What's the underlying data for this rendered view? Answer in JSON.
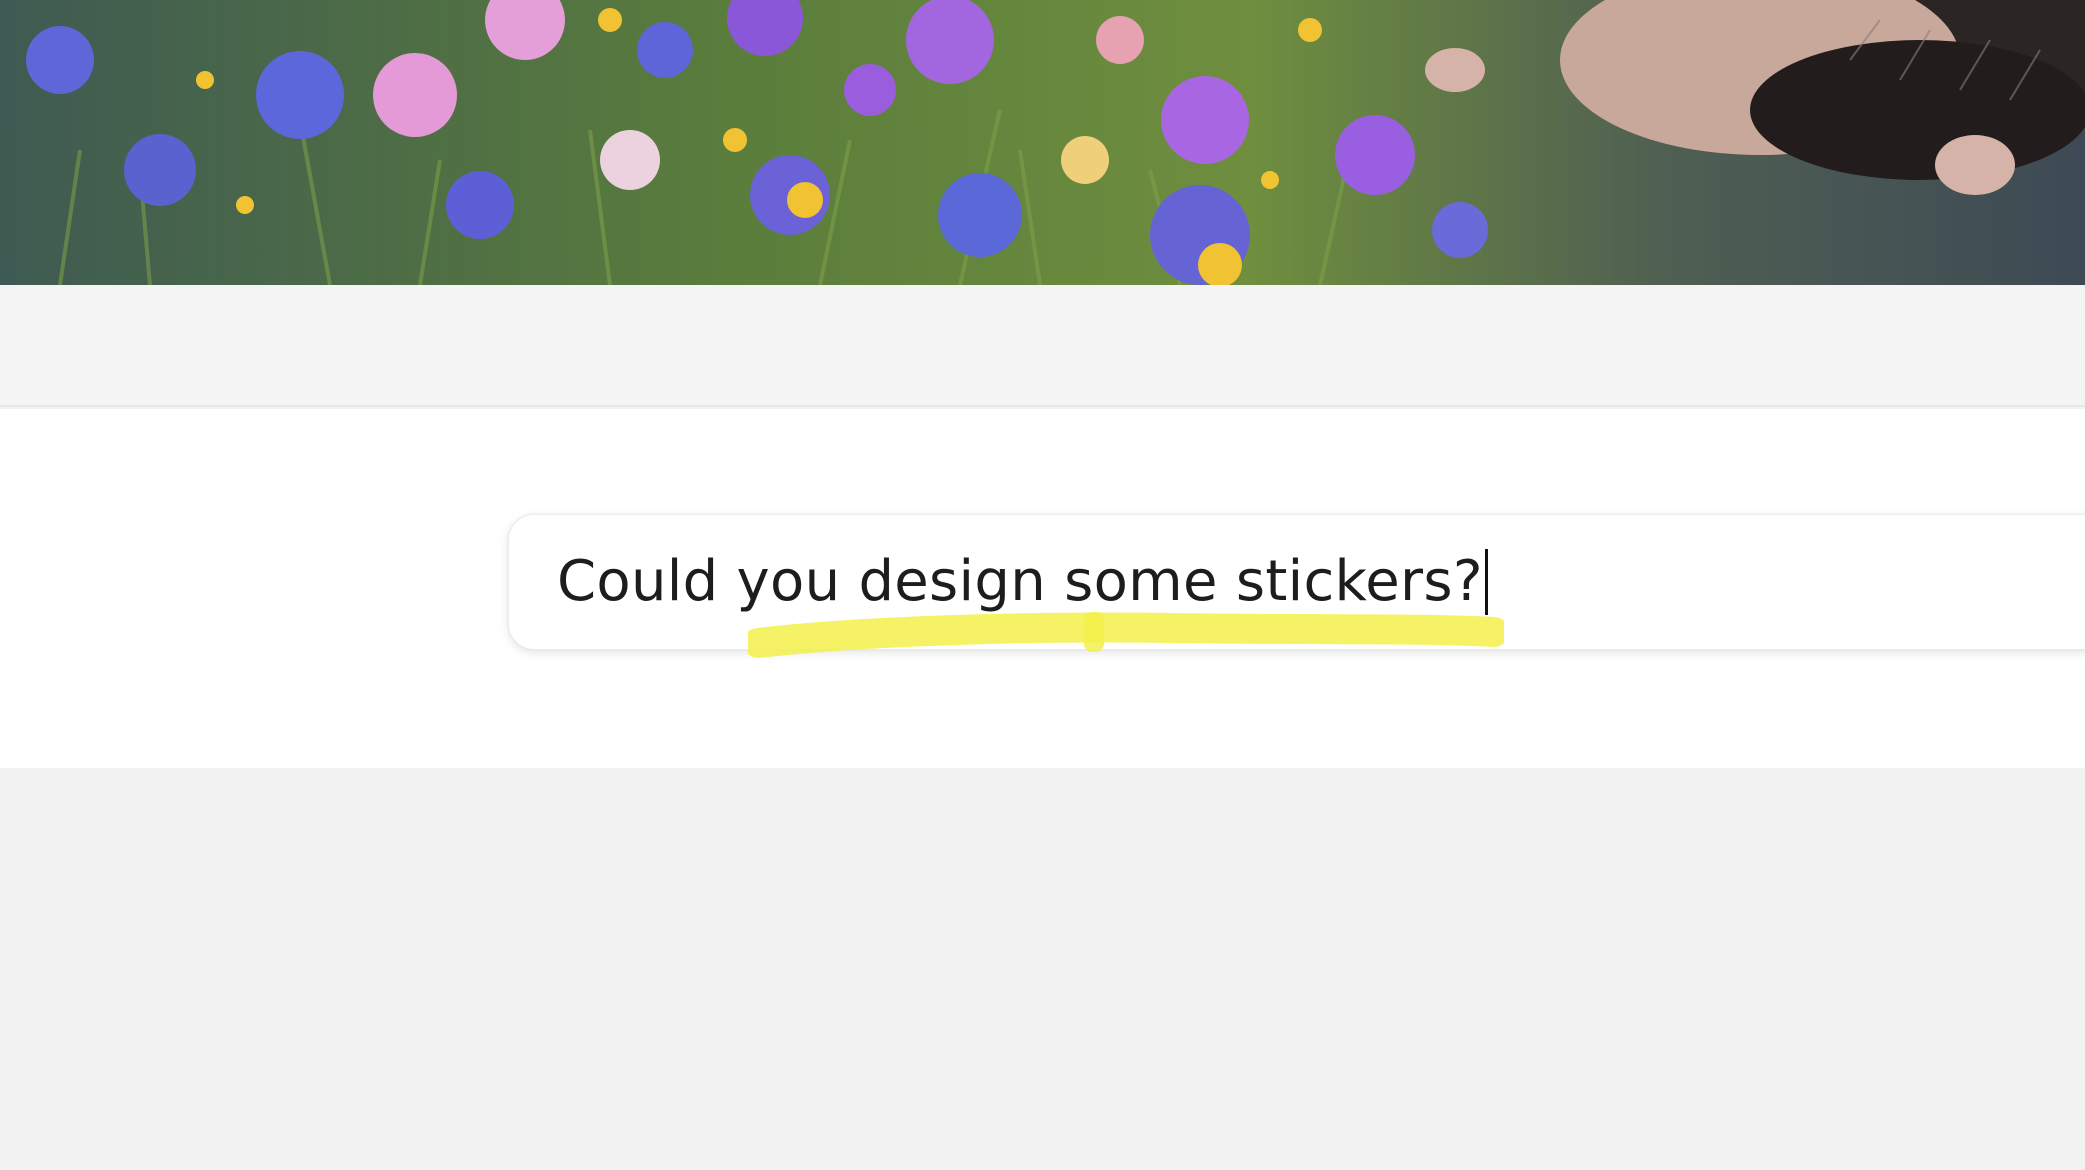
{
  "composer": {
    "prompt_value": "Could you design some stickers?"
  },
  "illustration": {
    "subject": "hedgehog in wildflower meadow",
    "palette": [
      "#3b4b55",
      "#4c6b3a",
      "#6b5bd6",
      "#a565e0",
      "#e79bd6",
      "#f1c232"
    ]
  },
  "colors": {
    "highlight": "#f3f04a",
    "page_background": "#f2f2f2",
    "composer_background": "#ffffff",
    "text": "#1d1d1d"
  },
  "icons": {
    "text-caret": "text-cursor"
  }
}
